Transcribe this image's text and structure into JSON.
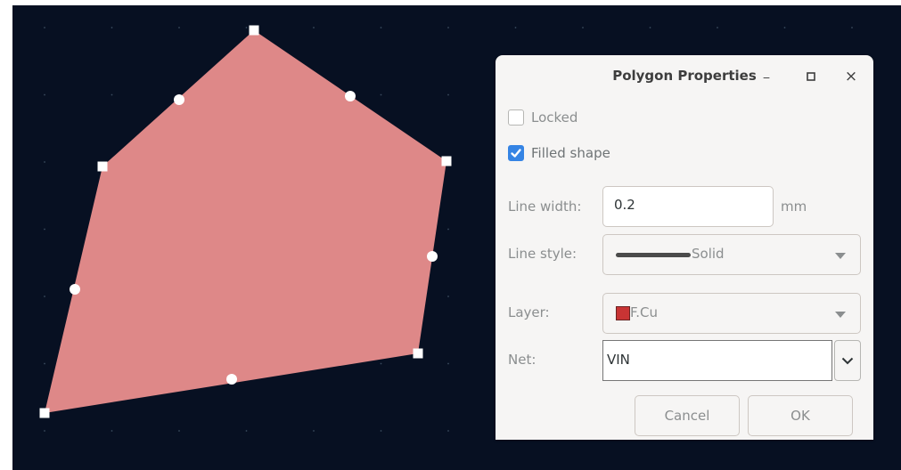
{
  "canvas": {
    "background": "#071022",
    "grid_color": "#3a4a5e",
    "polygon_fill": "#de8888",
    "handle_color": "#ffffff"
  },
  "dialog": {
    "title": "Polygon Properties",
    "minimize_label": "_",
    "close_label": "×",
    "locked": {
      "label": "Locked",
      "checked": false
    },
    "filled_shape": {
      "label": "Filled shape",
      "checked": true
    },
    "line_width": {
      "label": "Line width:",
      "value": "0.2",
      "units": "mm"
    },
    "line_style": {
      "label": "Line style:",
      "value": "Solid"
    },
    "layer": {
      "label": "Layer:",
      "value": "F.Cu",
      "swatch_color": "#c83434"
    },
    "net": {
      "label": "Net:",
      "value": "VIN"
    },
    "buttons": {
      "cancel": "Cancel",
      "ok": "OK"
    }
  }
}
